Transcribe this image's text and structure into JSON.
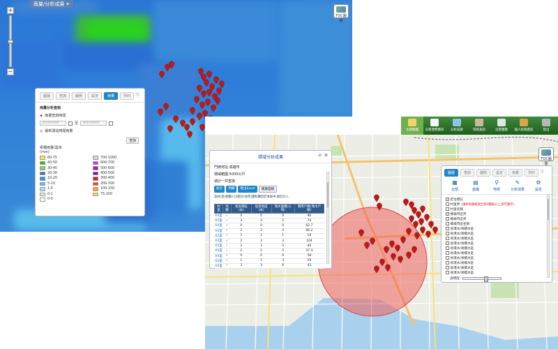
{
  "rainfall_map": {
    "title_tab": "雨量/分析成果",
    "toc_label": "TOC圖層",
    "tabs": [
      {
        "label": "圖層",
        "active": false
      },
      {
        "label": "查詢",
        "active": false
      },
      {
        "label": "圖例",
        "active": false
      },
      {
        "label": "設定",
        "active": false
      },
      {
        "label": "雨量",
        "active": true
      },
      {
        "label": "列印",
        "active": false
      }
    ],
    "panel_heading": "雨量分析查詢",
    "option_period": "雨量查詢時間",
    "date_from": "2014/0000",
    "date_to_sep": "至",
    "date_to": "2014/0000",
    "option_latest": "最新測站時間雨量",
    "query_button": "查詢",
    "legend_title_line1": "累積雨量/毫米",
    "legend_title_line2": "(mm)",
    "legend_left": [
      {
        "label": "60-75",
        "color": "#f5ea3d"
      },
      {
        "label": "40-50",
        "color": "#27c21e"
      },
      {
        "label": "30-40",
        "color": "#7ad46b"
      },
      {
        "label": "20-30",
        "color": "#3c68d8"
      },
      {
        "label": "10-20",
        "color": "#2e98e8"
      },
      {
        "label": "5-10",
        "color": "#58c0f0"
      },
      {
        "label": "1-5",
        "color": "#a6dcf6"
      },
      {
        "label": "0-1",
        "color": "#dcebf5"
      },
      {
        "label": "0-0",
        "color": "#ffffff"
      }
    ],
    "legend_right": [
      {
        "label": "700-1000",
        "color": "#e8c6ec"
      },
      {
        "label": "600-700",
        "color": "#c43ad8"
      },
      {
        "label": "500-600",
        "color": "#a91fb0"
      },
      {
        "label": "400-500",
        "color": "#7d1090"
      },
      {
        "label": "300-400",
        "color": "#d61f2a"
      },
      {
        "label": "200-300",
        "color": "#f04a20"
      },
      {
        "label": "100-150",
        "color": "#f5a623"
      },
      {
        "label": "75-100",
        "color": "#ffd75a"
      }
    ]
  },
  "buffer_map": {
    "toolbar": [
      {
        "label": "主題圖層",
        "active": true,
        "icon_color": "#f3d36b"
      },
      {
        "label": "災害潛勢資訊",
        "active": false,
        "icon_color": "#f6f6f6"
      },
      {
        "label": "分析成果",
        "active": false,
        "icon_color": "#8fc3ea"
      },
      {
        "label": "環境查詢",
        "active": false,
        "icon_color": "#c9b89a"
      },
      {
        "label": "災害圖資",
        "active": false,
        "icon_color": "#e4e4e4"
      },
      {
        "label": "個人防救資訊",
        "active": false,
        "icon_color": "#d8a44f"
      },
      {
        "label": "登出",
        "active": false,
        "icon_color": "#b7b7b7"
      }
    ],
    "toc_label": "TOC圖層",
    "zone_panel": {
      "title": "環域分析成果",
      "address_label": "門牌地址:高雄市",
      "range_label": "環域範圍:5000公尺",
      "total_label": "總計一共查詢",
      "buttons": [
        "統計",
        "明細",
        "匯出Excel",
        "樓層面積"
      ],
      "note": "該村(里)相關人口統計(住宅)資料顯示於本表中,統計計入",
      "columns": [
        "村里",
        "地圖",
        "易溢淹區(米)",
        "低窪地區(米)",
        "淹水面積(公頃)",
        "實際戶數(淹水戶數)"
      ],
      "rows": [
        [
          "XX里",
          "✓",
          "0",
          "0",
          "0",
          "96"
        ],
        [
          "XX里",
          "✓",
          "3",
          "3",
          "5",
          "74"
        ],
        [
          "XX里",
          "✓",
          "0",
          "0",
          "0",
          "62.7"
        ],
        [
          "XX里",
          "✓",
          "2",
          "2",
          "4",
          "66.2"
        ],
        [
          "XX里",
          "✓",
          "1",
          "1",
          "1",
          "18"
        ],
        [
          "XX里",
          "✓",
          "2",
          "3",
          "3",
          "104"
        ],
        [
          "XX里",
          "✓",
          "2",
          "3",
          "5",
          "40"
        ],
        [
          "XX里",
          "✓",
          "2",
          "2",
          "5",
          "37.3"
        ],
        [
          "XX里",
          "✓",
          "0",
          "0",
          "0",
          "58"
        ],
        [
          "XX里",
          "✓",
          "1",
          "1",
          "3",
          "19"
        ],
        [
          "XX里",
          "✓",
          "3",
          "3",
          "6",
          "43"
        ]
      ]
    },
    "layer_panel": {
      "tabs": [
        {
          "label": "圖層",
          "active": true
        },
        {
          "label": "查詢",
          "active": false
        },
        {
          "label": "圖例",
          "active": false
        },
        {
          "label": "設定",
          "active": false
        },
        {
          "label": "雨量",
          "active": false
        },
        {
          "label": "列印",
          "active": false
        }
      ],
      "icons": [
        {
          "label": "全部",
          "icon": "grid"
        },
        {
          "label": "基礎",
          "icon": "building"
        },
        {
          "label": "地標",
          "icon": "pin"
        },
        {
          "label": "分析成果",
          "icon": "wrench"
        },
        {
          "label": "設定",
          "icon": "gear"
        }
      ],
      "items": [
        {
          "label": "定位標記",
          "checked": true,
          "note": ""
        },
        {
          "label": "村里界",
          "checked": false,
          "note": "(請將地圖縮放至第9層級以上,即可顯示)"
        },
        {
          "label": "村里名稱",
          "checked": false,
          "note": ""
        },
        {
          "label": "鄉鎮市區界",
          "checked": true,
          "note": ""
        },
        {
          "label": "鄉鎮市區界",
          "checked": false,
          "note": ""
        },
        {
          "label": "鄉鎮市區名稱",
          "checked": false,
          "note": ""
        },
        {
          "label": "易淹水/易積水區",
          "checked": false,
          "note": ""
        },
        {
          "label": "易淹水/易積水區",
          "checked": false,
          "note": ""
        },
        {
          "label": "易淹水/易積水區",
          "checked": false,
          "note": ""
        },
        {
          "label": "易淹水/易積水區",
          "checked": false,
          "note": ""
        },
        {
          "label": "易淹水/易積水區",
          "checked": false,
          "note": ""
        },
        {
          "label": "易淹水/易積水區",
          "checked": false,
          "note": ""
        },
        {
          "label": "易淹水/易積水區",
          "checked": false,
          "note": ""
        },
        {
          "label": "易淹水/易積水區",
          "checked": false,
          "note": ""
        },
        {
          "label": "易淹水/易積水區",
          "checked": false,
          "note": ""
        },
        {
          "label": "易淹水/易積水區",
          "checked": false,
          "note": ""
        }
      ],
      "transparency_label": "透明度:"
    }
  },
  "colors": {
    "buffer_circle": "#f0605d",
    "marker": "#c01818",
    "panel_accent": "#1f86c8",
    "toolbar_green": "#2e7a2c"
  }
}
